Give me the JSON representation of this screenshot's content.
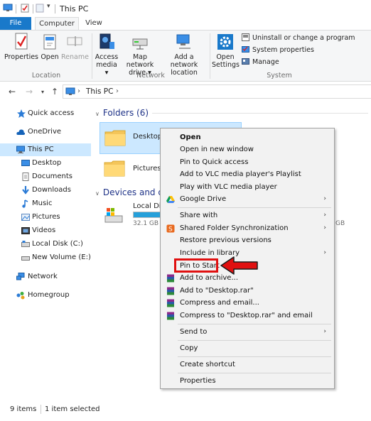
{
  "window": {
    "title": "This PC"
  },
  "tabs": [
    {
      "label": "File"
    },
    {
      "label": "Computer"
    },
    {
      "label": "View"
    }
  ],
  "ribbon": {
    "location": {
      "label": "Location",
      "buttons": [
        {
          "label": "Properties",
          "icon": "properties-icon"
        },
        {
          "label": "Open",
          "icon": "open-icon"
        },
        {
          "label": "Rename",
          "icon": "rename-icon"
        }
      ]
    },
    "network": {
      "label": "Network",
      "buttons": [
        {
          "label_line1": "Access",
          "label_line2": "media ▾",
          "icon": "access-media-icon"
        },
        {
          "label_line1": "Map network",
          "label_line2": "drive ▾",
          "icon": "map-network-drive-icon"
        },
        {
          "label_line1": "Add a network",
          "label_line2": "location",
          "icon": "add-network-location-icon"
        }
      ]
    },
    "system": {
      "label": "System",
      "open_settings_line1": "Open",
      "open_settings_line2": "Settings",
      "small": [
        {
          "label": "Uninstall or change a program",
          "icon": "uninstall-icon"
        },
        {
          "label": "System properties",
          "icon": "system-properties-icon"
        },
        {
          "label": "Manage",
          "icon": "manage-icon"
        }
      ]
    }
  },
  "address": {
    "path": "This PC",
    "separator": "›"
  },
  "nav": {
    "items": [
      {
        "label": "Quick access",
        "icon": "star-icon"
      },
      {
        "label": "OneDrive",
        "icon": "cloud-icon"
      },
      {
        "label": "This PC",
        "icon": "computer-icon"
      },
      {
        "label": "Desktop",
        "icon": "desktop-icon"
      },
      {
        "label": "Documents",
        "icon": "documents-icon"
      },
      {
        "label": "Downloads",
        "icon": "downloads-icon"
      },
      {
        "label": "Music",
        "icon": "music-icon"
      },
      {
        "label": "Pictures",
        "icon": "pictures-icon"
      },
      {
        "label": "Videos",
        "icon": "videos-icon"
      },
      {
        "label": "Local Disk (C:)",
        "icon": "local-disk-icon"
      },
      {
        "label": "New Volume (E:)",
        "icon": "drive-icon"
      },
      {
        "label": "Network",
        "icon": "network-icon"
      },
      {
        "label": "Homegroup",
        "icon": "homegroup-icon"
      }
    ]
  },
  "content": {
    "folders_header": "Folders (6)",
    "devices_header": "Devices and dr",
    "folders": [
      {
        "label": "Desktop"
      },
      {
        "label": "Pictures"
      }
    ],
    "drives": [
      {
        "label": "Local Dis",
        "free": "32.1 GB fr",
        "used_fraction": 0.75
      }
    ],
    "right_partial_free": "GB"
  },
  "context_menu": {
    "items": [
      {
        "label": "Open",
        "bold": true
      },
      {
        "label": "Open in new window"
      },
      {
        "label": "Pin to Quick access"
      },
      {
        "label": "Add to VLC media player's Playlist"
      },
      {
        "label": "Play with VLC media player"
      },
      {
        "label": "Google Drive",
        "icon": "google-drive-icon",
        "submenu": true
      },
      {
        "label": "Share with",
        "submenu": true
      },
      {
        "label": "Shared Folder Synchronization",
        "icon": "sync-icon",
        "submenu": true
      },
      {
        "label": "Restore previous versions"
      },
      {
        "label": "Include in library",
        "submenu": true
      },
      {
        "label": "Pin to Start"
      },
      {
        "label": "Add to archive...",
        "icon": "winrar-icon"
      },
      {
        "label": "Add to \"Desktop.rar\"",
        "icon": "winrar-icon"
      },
      {
        "label": "Compress and email...",
        "icon": "winrar-icon"
      },
      {
        "label": "Compress to \"Desktop.rar\" and email",
        "icon": "winrar-icon"
      },
      {
        "label": "Send to",
        "submenu": true
      },
      {
        "label": "Copy"
      },
      {
        "label": "Create shortcut"
      },
      {
        "label": "Properties"
      }
    ],
    "submenu_arrow": "›"
  },
  "status": {
    "items_count": "9 items",
    "selected": "1 item selected"
  },
  "colors": {
    "accent": "#1979ca",
    "selection": "#cce8ff",
    "highlight": "#e01010",
    "header_text": "#1e3287"
  }
}
